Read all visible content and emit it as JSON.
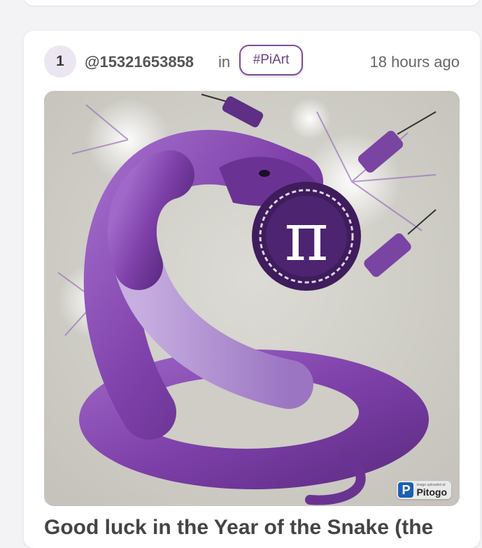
{
  "post": {
    "rank": "1",
    "author": "@15321653858",
    "in_word": "in",
    "tag": "#PiArt",
    "time": "18 hours ago",
    "title": "Good luck in the Year of the Snake (the",
    "badge": {
      "small_text": "image uploaded at",
      "brand": "Pitogo",
      "logo_letter": "P"
    },
    "image": {
      "symbol": "π",
      "colors": {
        "background": "#cfcdc6",
        "snake": "#8a4fb3",
        "snake_dark": "#4f2470",
        "belly": "#b99ad4",
        "coin": "#3f1c5b"
      }
    }
  }
}
